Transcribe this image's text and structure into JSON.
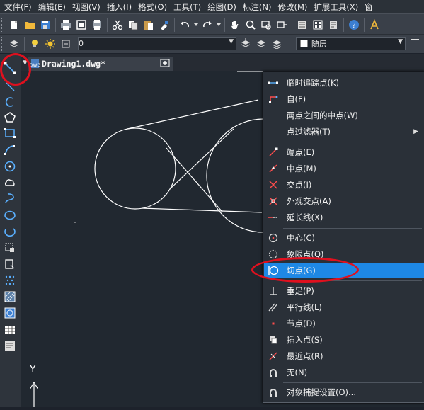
{
  "menubar": {
    "items": [
      "文件(F)",
      "编辑(E)",
      "视图(V)",
      "插入(I)",
      "格式(O)",
      "工具(T)",
      "绘图(D)",
      "标注(N)",
      "修改(M)",
      "扩展工具(X)",
      "窗"
    ]
  },
  "toolbar2": {
    "layer_value": "0",
    "color_value": "随层"
  },
  "tabs": {
    "drawing_tab": "Drawing1.dwg*",
    "dwg_badge": "DWG",
    "close_glyph": "✕",
    "new_tab_glyph": "+"
  },
  "canvas": {
    "ucs_y": "Y"
  },
  "context_menu": {
    "items": [
      {
        "label": "临时追踪点(K)",
        "icon": "track-icon"
      },
      {
        "label": "自(F)",
        "icon": "from-icon"
      },
      {
        "label": "两点之间的中点(W)",
        "icon": ""
      },
      {
        "label": "点过滤器(T)",
        "icon": "",
        "submenu": true
      },
      {
        "label": "端点(E)",
        "icon": "endpoint-icon"
      },
      {
        "label": "中点(M)",
        "icon": "midpoint-icon"
      },
      {
        "label": "交点(I)",
        "icon": "intersection-icon"
      },
      {
        "label": "外观交点(A)",
        "icon": "apparent-intersection-icon"
      },
      {
        "label": "延长线(X)",
        "icon": "extension-icon"
      },
      {
        "label": "中心(C)",
        "icon": "center-icon"
      },
      {
        "label": "象限点(Q)",
        "icon": "quadrant-icon"
      },
      {
        "label": "切点(G)",
        "icon": "tangent-icon",
        "highlighted": true
      },
      {
        "label": "垂足(P)",
        "icon": "perpendicular-icon"
      },
      {
        "label": "平行线(L)",
        "icon": "parallel-icon"
      },
      {
        "label": "节点(D)",
        "icon": "node-icon"
      },
      {
        "label": "插入点(S)",
        "icon": "insert-icon"
      },
      {
        "label": "最近点(R)",
        "icon": "nearest-icon"
      },
      {
        "label": "无(N)",
        "icon": "none-icon"
      },
      {
        "label": "对象捕捉设置(O)...",
        "icon": "osnap-settings-icon"
      }
    ]
  },
  "colors": {
    "highlight": "#1e88e5",
    "annotation_red": "#e0101e",
    "canvas_bg": "#212830"
  }
}
